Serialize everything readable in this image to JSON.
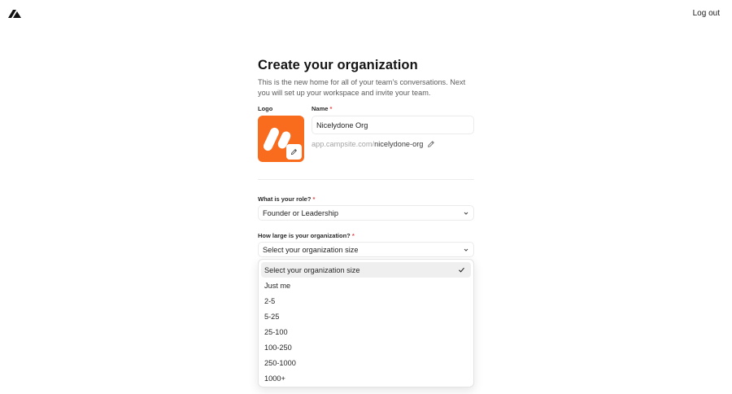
{
  "header": {
    "logout_label": "Log out"
  },
  "page": {
    "title": "Create your organization",
    "subtitle": "This is the new home for all of your team’s conversations. Next you will set up your workspace and invite your team."
  },
  "form": {
    "logo_label": "Logo",
    "name_label": "Name",
    "required_mark": "*",
    "name_value": "Nicelydone Org",
    "slug_prefix": "app.campsite.com/",
    "slug_value": "nicelydone-org",
    "role_label": "What is your role?",
    "role_value": "Founder or Leadership",
    "size_label": "How large is your organization?",
    "size_value": "Select your organization size"
  },
  "size_options": [
    {
      "label": "Select your organization size",
      "selected": true
    },
    {
      "label": "Just me"
    },
    {
      "label": "2-5"
    },
    {
      "label": "5-25"
    },
    {
      "label": "25-100"
    },
    {
      "label": "100-250"
    },
    {
      "label": "250-1000"
    },
    {
      "label": "1000+"
    }
  ],
  "icons": {
    "app_logo": "campsite-logo-icon",
    "edit": "pencil-icon",
    "dropdown": "chevron-down-icon",
    "selected": "check-icon"
  },
  "colors": {
    "logo_tile": "#f96c1e",
    "required": "#e5484d",
    "accent_text": "#151515"
  }
}
